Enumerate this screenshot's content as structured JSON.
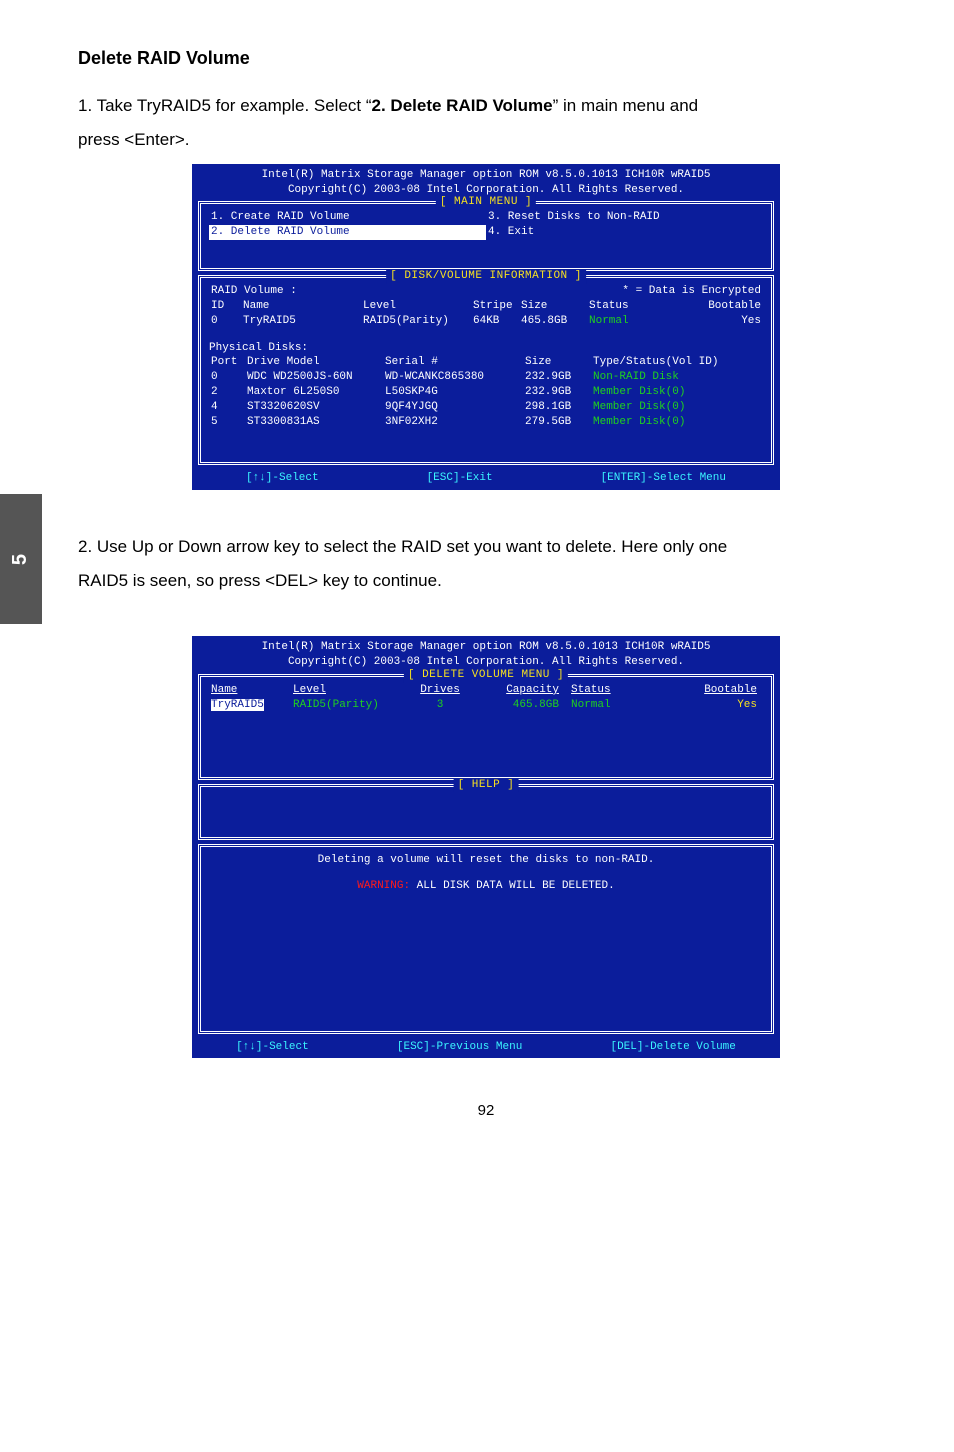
{
  "section_title": "Delete RAID Volume",
  "step1": {
    "prefix": "1. Take TryRAID5 for example. Select “",
    "bold": "2. Delete RAID Volume",
    "suffix": "” in main menu and",
    "line2": "press <Enter>."
  },
  "step2": {
    "line1": "2. Use Up or Down arrow key to select the RAID set you want to delete. Here only one",
    "line2": "RAID5 is seen, so press <DEL> key to continue."
  },
  "side_tab": "5",
  "page_number": "92",
  "bios_header": {
    "l1": "Intel(R) Matrix Storage Manager option ROM v8.5.0.1013 ICH10R wRAID5",
    "l2": "Copyright(C) 2003-08 Intel Corporation.   All Rights Reserved."
  },
  "main_menu": {
    "title": "[ MAIN MENU ]",
    "items": [
      {
        "label": "1. Create RAID Volume",
        "selected": false
      },
      {
        "label": "2. Delete RAID Volume",
        "selected": true
      },
      {
        "label": "3. Reset Disks to Non-RAID",
        "selected": false
      },
      {
        "label": "4. Exit",
        "selected": false
      }
    ]
  },
  "info_box": {
    "title": "[ DISK/VOLUME INFORMATION ]",
    "encrypted_note": "* = Data is Encrypted",
    "raid_label": "RAID Volume :",
    "raid_headers": {
      "id": "ID",
      "name": "Name",
      "level": "Level",
      "stripe": "Stripe",
      "size": "Size",
      "status": "Status",
      "bootable": "Bootable"
    },
    "raid_row": {
      "id": "0",
      "name": "TryRAID5",
      "level": "RAID5(Parity)",
      "stripe": "64KB",
      "size": "465.8GB",
      "status": "Normal",
      "bootable": "Yes"
    },
    "pd_label": "Physical Disks:",
    "pd_headers": {
      "port": "Port",
      "model": "Drive Model",
      "serial": "Serial #",
      "size": "Size",
      "type": "Type/Status(Vol ID)"
    },
    "pd_rows": [
      {
        "port": "0",
        "model": "WDC WD2500JS-60N",
        "serial": "WD-WCANKC865380",
        "size": "232.9GB",
        "type": "Non-RAID Disk"
      },
      {
        "port": "2",
        "model": "Maxtor 6L250S0",
        "serial": "L50SKP4G",
        "size": "232.9GB",
        "type": "Member Disk(0)"
      },
      {
        "port": "4",
        "model": "ST3320620SV",
        "serial": "9QF4YJGQ",
        "size": "298.1GB",
        "type": "Member Disk(0)"
      },
      {
        "port": "5",
        "model": "ST3300831AS",
        "serial": "3NF02XH2",
        "size": "279.5GB",
        "type": "Member Disk(0)"
      }
    ]
  },
  "footer1": {
    "a": "[↑↓]-Select",
    "b": "[ESC]-Exit",
    "c": "[ENTER]-Select Menu"
  },
  "del_menu": {
    "title": "[ DELETE VOLUME MENU ]",
    "headers": {
      "name": "Name",
      "level": "Level",
      "drives": "Drives",
      "capacity": "Capacity",
      "status": "Status",
      "bootable": "Bootable"
    },
    "row": {
      "name": "TryRAID5",
      "level": "RAID5(Parity)",
      "drives": "3",
      "capacity": "465.8GB",
      "status": "Normal",
      "bootable": "Yes"
    }
  },
  "help_title": "[ HELP ]",
  "warn": {
    "l1": "Deleting a volume will reset the disks to non-RAID.",
    "l2a": "WARNING:",
    "l2b": " ALL DISK DATA WILL BE DELETED."
  },
  "footer2": {
    "a": "[↑↓]-Select",
    "b": "[ESC]-Previous Menu",
    "c": "[DEL]-Delete Volume"
  }
}
